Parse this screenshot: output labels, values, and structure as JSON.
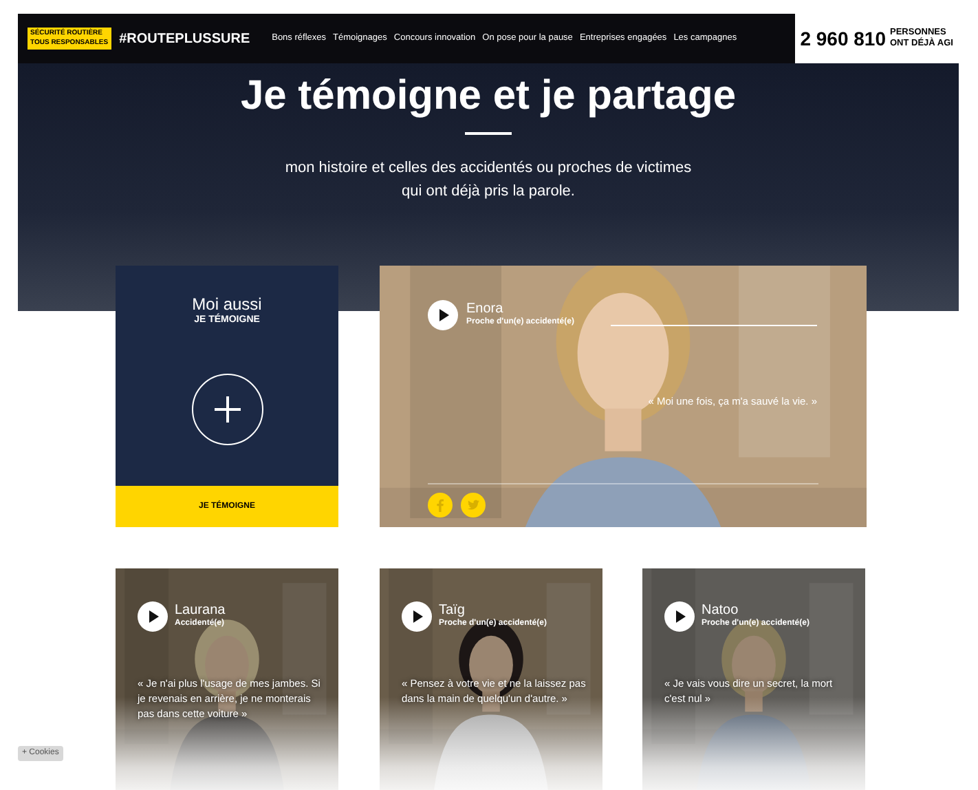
{
  "header": {
    "logo_lines": [
      "SÉCURITÉ ROUTIÈRE",
      "TOUS RESPONSABLES"
    ],
    "hashtag": "#ROUTEPLUSSURE",
    "nav": [
      {
        "label": "Bons réflexes",
        "selected": false
      },
      {
        "label": "Témoignages",
        "selected": false
      },
      {
        "label": "Concours innovation",
        "selected": false
      },
      {
        "label": "On pose pour la pause",
        "selected": false
      },
      {
        "label": "Entreprises engagées",
        "selected": false
      },
      {
        "label": "Les campagnes",
        "selected": false
      }
    ],
    "counter": {
      "value": "2 960 810",
      "caption_lines": [
        "PERSONNES",
        "ONT DÉJÀ AGI"
      ]
    }
  },
  "hero": {
    "title": "Je témoigne et je partage",
    "subtitle": "mon histoire et celles des accidentés ou proches de victimes qui ont déjà pris la parole."
  },
  "join_card": {
    "title": "Moi aussi",
    "subtitle": "JE TÉMOIGNE",
    "button": "JE TÉMOIGNE"
  },
  "featured": {
    "name": "Enora",
    "role": "Proche d'un(e) accidenté(e)",
    "quote": "« Moi une fois, ça m'a sauvé la vie. »"
  },
  "testimonials": [
    {
      "name": "Laurana",
      "role": "Accidenté(e)",
      "quote": "« Je n'ai plus l'usage de mes jambes. Si je revenais en arrière, je ne monterais pas dans cette voiture »"
    },
    {
      "name": "Taïg",
      "role": "Proche d'un(e) accidenté(e)",
      "quote": "« Pensez à votre vie et ne la laissez pas dans la main de quelqu'un d'autre. »"
    },
    {
      "name": "Natoo",
      "role": "Proche d'un(e) accidenté(e)",
      "quote": "« Je vais vous dire un secret, la mort c'est nul »"
    }
  ],
  "cookies_button": "+ Cookies"
}
